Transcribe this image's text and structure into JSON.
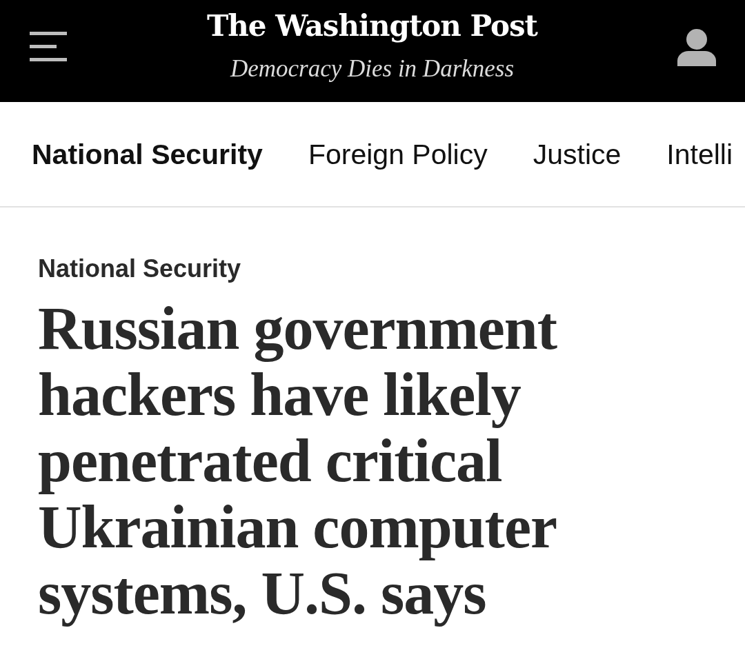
{
  "header": {
    "logo": "The Washington Post",
    "tagline": "Democracy Dies in Darkness"
  },
  "nav": {
    "items": [
      {
        "label": "National Security",
        "selected": true
      },
      {
        "label": "Foreign Policy",
        "selected": false
      },
      {
        "label": "Justice",
        "selected": false
      },
      {
        "label": "Intelli",
        "selected": false
      }
    ]
  },
  "article": {
    "kicker": "National Security",
    "headline": "Russian government hackers have likely penetrated critical Ukrainian computer systems, U.S. says"
  }
}
